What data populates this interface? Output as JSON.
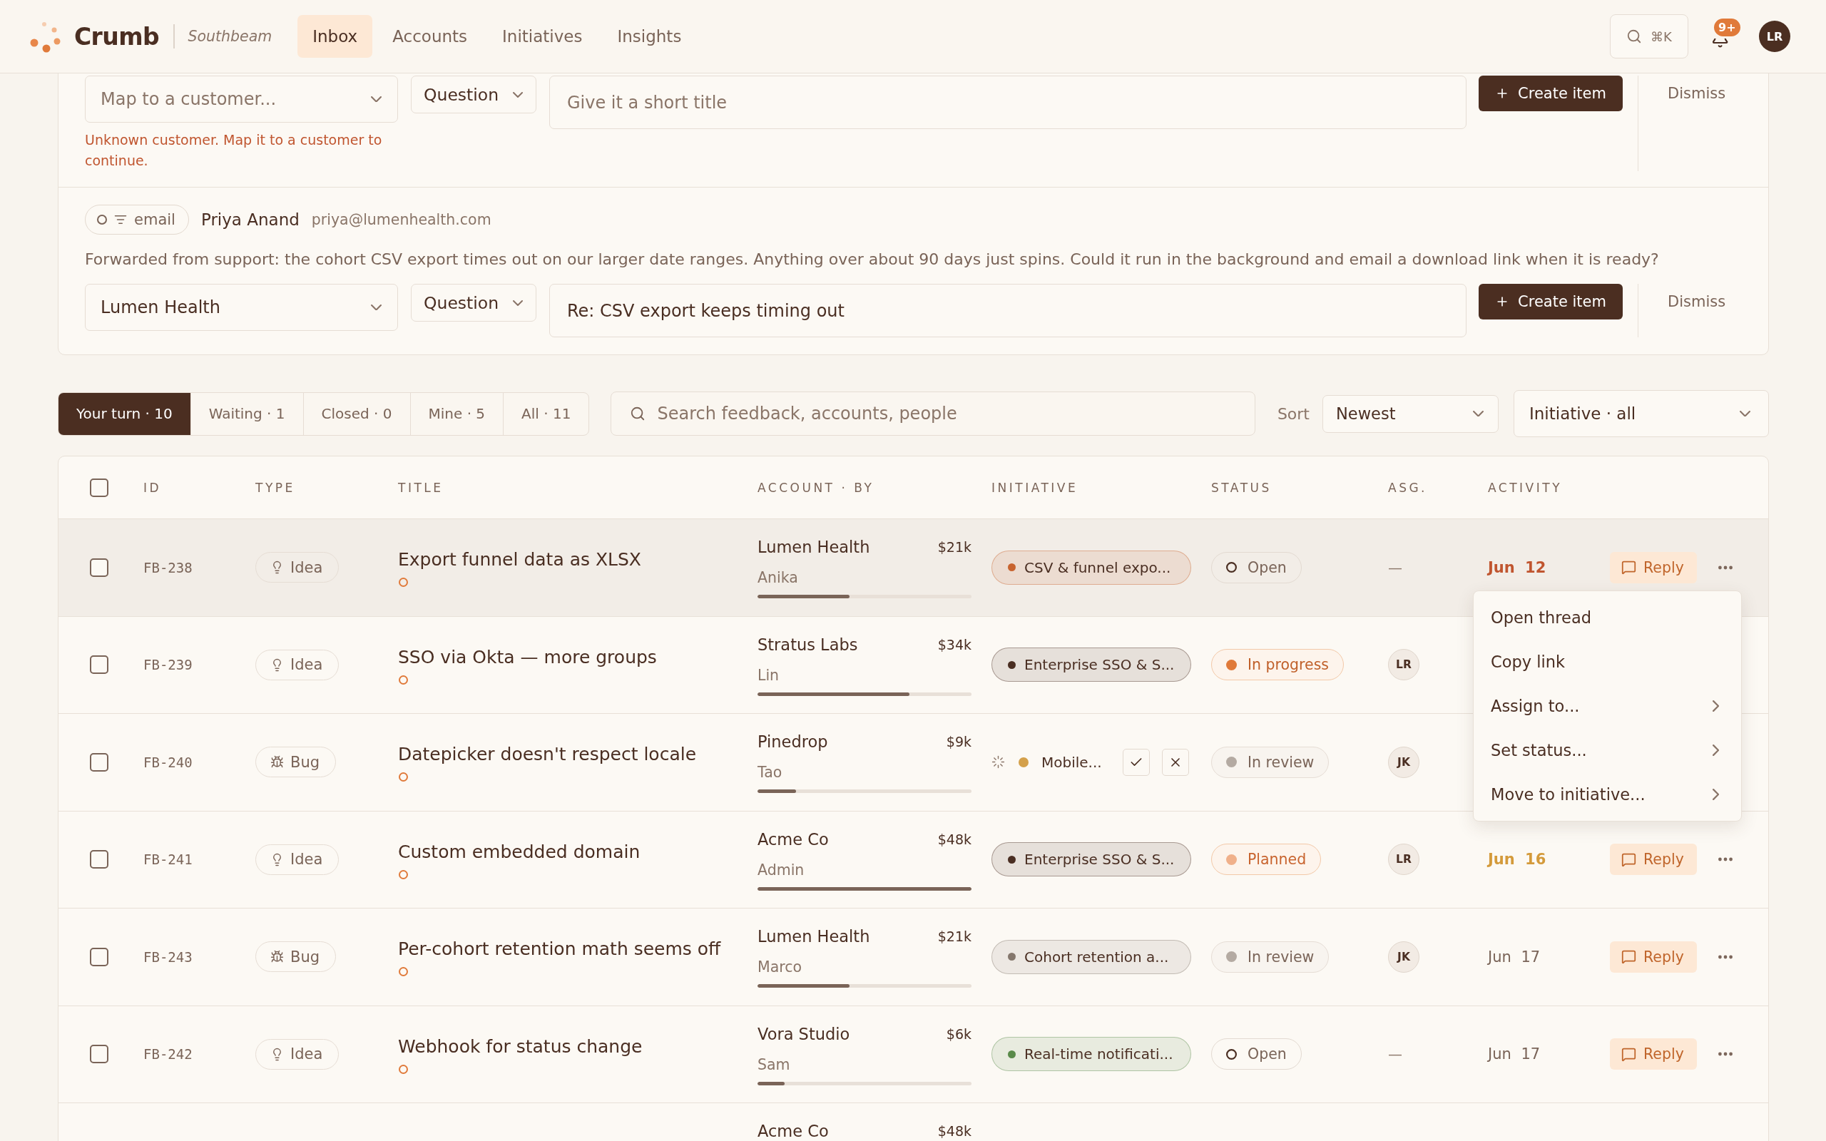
{
  "app_bar": {
    "brand": "Crumb",
    "workspace": "Southbeam",
    "nav": [
      {
        "label": "Inbox",
        "selected": true
      },
      {
        "label": "Accounts",
        "selected": false
      },
      {
        "label": "Initiatives",
        "selected": false
      },
      {
        "label": "Insights",
        "selected": false
      }
    ],
    "search_shortcut": "⌘K",
    "notification_badge": "9+",
    "avatar": "LR"
  },
  "triage": {
    "items": [
      {
        "customer_select": {
          "placeholder": "Map to a customer..."
        },
        "type_select": "Question",
        "title_field": {
          "placeholder": "Give it a short title"
        },
        "create_button": "Create item",
        "dismiss": "Dismiss",
        "error": "Unknown customer. Map it to a customer to continue."
      },
      {
        "source": "email",
        "sender": "Priya Anand",
        "sender_email": "priya@lumenhealth.com",
        "message": "Forwarded from support: the cohort CSV export times out on our larger date ranges. Anything over about 90 days just spins. Could it run in the background and email a download link when it is ready?",
        "customer_select": {
          "value": "Lumen Health"
        },
        "type_select": "Question",
        "title_field": {
          "value": "Re: CSV export keeps timing out"
        },
        "create_button": "Create item",
        "dismiss": "Dismiss"
      }
    ]
  },
  "filters": {
    "tabs": [
      {
        "label": "Your turn · 10",
        "selected": true
      },
      {
        "label": "Waiting · 1",
        "selected": false
      },
      {
        "label": "Closed · 0",
        "selected": false
      },
      {
        "label": "Mine · 5",
        "selected": false
      },
      {
        "label": "All · 11",
        "selected": false
      }
    ],
    "search": {
      "placeholder": "Search feedback, accounts, people"
    },
    "sort_label": "Sort",
    "sort": "Newest",
    "initiative_filter": "Initiative · all"
  },
  "table": {
    "select_all_checked": false,
    "columns": [
      "ID",
      "TYPE",
      "TITLE",
      "ACCOUNT · BY",
      "INITIATIVE",
      "STATUS",
      "ASG.",
      "ACTIVITY"
    ],
    "rows": [
      {
        "id": "FB-238",
        "selected": true,
        "checked": false,
        "type": {
          "kind": "idea",
          "label": "Idea"
        },
        "title": "Export funnel data as XLSX",
        "unread": true,
        "account": "Lumen Health",
        "amount": "$21k",
        "by": "Anika",
        "level": 0.43,
        "initiative": {
          "kind": "tag",
          "label": "CSV & funnel expo...",
          "color": "#c8642f"
        },
        "status": {
          "kind": "open",
          "label": "Open"
        },
        "assignee": {
          "kind": "none",
          "label": "—"
        },
        "activity": {
          "label": "Jun 12",
          "kind": "overdue"
        },
        "reply": "Reply"
      },
      {
        "id": "FB-239",
        "selected": false,
        "checked": false,
        "type": {
          "kind": "idea",
          "label": "Idea"
        },
        "title": "SSO via Okta — more groups",
        "unread": true,
        "account": "Stratus Labs",
        "amount": "$34k",
        "by": "Lin",
        "level": 0.71,
        "initiative": {
          "kind": "tag",
          "label": "Enterprise SSO & S...",
          "color": "#4a2e22"
        },
        "status": {
          "kind": "in_progress",
          "label": "In progress"
        },
        "assignee": {
          "kind": "avatar",
          "label": "LR"
        }
      },
      {
        "id": "FB-240",
        "selected": false,
        "checked": false,
        "type": {
          "kind": "bug",
          "label": "Bug"
        },
        "title": "Datepicker doesn't respect locale",
        "unread": true,
        "account": "Pinedrop",
        "amount": "$9k",
        "by": "Tao",
        "level": 0.18,
        "initiative": {
          "kind": "suggestion",
          "label": "Mobile...",
          "color": "#d4a04a"
        },
        "status": {
          "kind": "in_review",
          "label": "In review"
        },
        "assignee": {
          "kind": "avatar",
          "label": "JK"
        }
      },
      {
        "id": "FB-241",
        "selected": false,
        "checked": false,
        "type": {
          "kind": "idea",
          "label": "Idea"
        },
        "title": "Custom embedded domain",
        "unread": true,
        "account": "Acme Co",
        "amount": "$48k",
        "by": "Admin",
        "level": 1,
        "initiative": {
          "kind": "tag",
          "label": "Enterprise SSO & S...",
          "color": "#4a2e22"
        },
        "status": {
          "kind": "planned",
          "label": "Planned"
        },
        "assignee": {
          "kind": "avatar",
          "label": "LR"
        },
        "activity": {
          "label": "Jun 16",
          "kind": "due_soon"
        },
        "reply": "Reply"
      },
      {
        "id": "FB-243",
        "selected": false,
        "checked": false,
        "type": {
          "kind": "bug",
          "label": "Bug"
        },
        "title": "Per-cohort retention math seems off",
        "unread": true,
        "account": "Lumen Health",
        "amount": "$21k",
        "by": "Marco",
        "level": 0.43,
        "initiative": {
          "kind": "tag",
          "label": "Cohort retention a...",
          "color": "#85776d"
        },
        "status": {
          "kind": "in_review",
          "label": "In review"
        },
        "assignee": {
          "kind": "avatar",
          "label": "JK"
        },
        "activity": {
          "label": "Jun 17",
          "kind": "normal"
        },
        "reply": "Reply"
      },
      {
        "id": "FB-242",
        "selected": false,
        "checked": false,
        "type": {
          "kind": "idea",
          "label": "Idea"
        },
        "title": "Webhook for status change",
        "unread": true,
        "account": "Vora Studio",
        "amount": "$6k",
        "by": "Sam",
        "level": 0.125,
        "initiative": {
          "kind": "tag",
          "label": "Real-time notificati...",
          "color": "#5a8a4a"
        },
        "status": {
          "kind": "open",
          "label": "Open"
        },
        "assignee": {
          "kind": "none",
          "label": "—"
        },
        "activity": {
          "label": "Jun 17",
          "kind": "normal"
        },
        "reply": "Reply"
      },
      {
        "selected": false,
        "account": "Acme Co",
        "amount": "$48k"
      }
    ],
    "row_menu": {
      "items": [
        {
          "label": "Open thread",
          "submenu": false
        },
        {
          "label": "Copy link",
          "submenu": false
        },
        {
          "label": "Assign to...",
          "submenu": true
        },
        {
          "label": "Set status...",
          "submenu": true
        },
        {
          "label": "Move to initiative...",
          "submenu": true
        }
      ]
    }
  }
}
